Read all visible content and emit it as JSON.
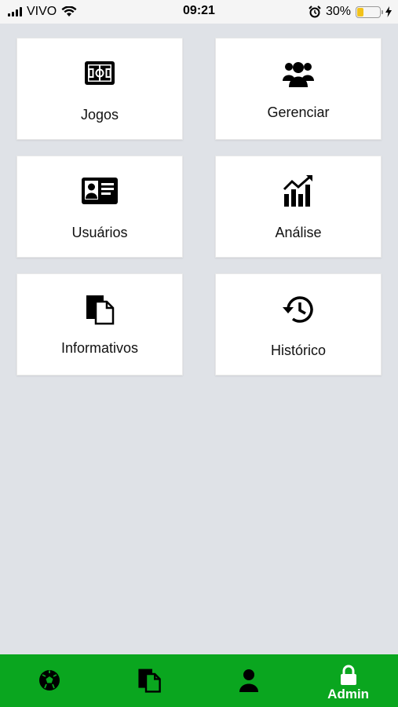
{
  "status_bar": {
    "carrier": "VIVO",
    "time": "09:21",
    "battery": "30%",
    "battery_level": 0.3
  },
  "menu": [
    {
      "label": "Jogos",
      "icon": "soccer-field-icon"
    },
    {
      "label": "Gerenciar",
      "icon": "users-group-icon"
    },
    {
      "label": "Usuários",
      "icon": "id-card-icon"
    },
    {
      "label": "Análise",
      "icon": "chart-trend-icon"
    },
    {
      "label": "Informativos",
      "icon": "documents-icon"
    },
    {
      "label": "Histórico",
      "icon": "history-icon"
    }
  ],
  "tabbar": {
    "active_color": "#0aa61f",
    "tabs": [
      {
        "icon": "soccer-ball-icon",
        "label": ""
      },
      {
        "icon": "documents-icon",
        "label": ""
      },
      {
        "icon": "user-icon",
        "label": ""
      },
      {
        "icon": "lock-icon",
        "label": "Admin"
      }
    ]
  }
}
